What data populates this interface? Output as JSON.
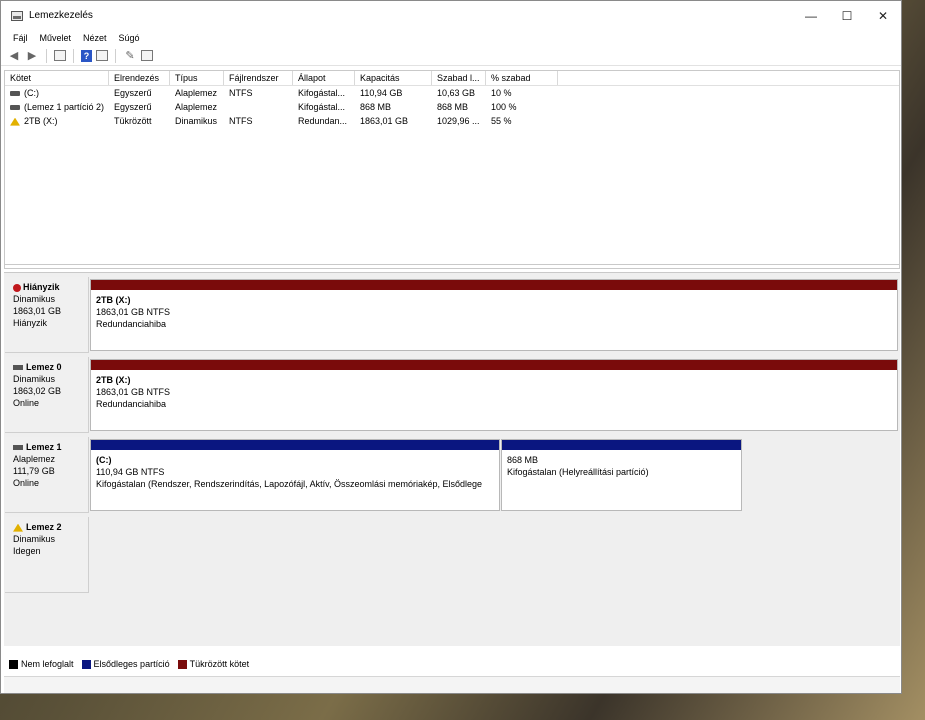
{
  "window": {
    "title": "Lemezkezelés"
  },
  "menu": [
    "Fájl",
    "Művelet",
    "Nézet",
    "Súgó"
  ],
  "columns": [
    "Kötet",
    "Elrendezés",
    "Típus",
    "Fájlrendszer",
    "Állapot",
    "Kapacitás",
    "Szabad l...",
    "% szabad"
  ],
  "volumes": [
    {
      "kotet": "(C:)",
      "elrendezes": "Egyszerű",
      "tipus": "Alaplemez",
      "fajlrendszer": "NTFS",
      "allapot": "Kifogástal...",
      "kapacitas": "110,94 GB",
      "szabad": "10,63 GB",
      "szabad_pct": "10 %"
    },
    {
      "kotet": "(Lemez 1 partíció 2)",
      "elrendezes": "Egyszerű",
      "tipus": "Alaplemez",
      "fajlrendszer": "",
      "allapot": "Kifogástal...",
      "kapacitas": "868 MB",
      "szabad": "868 MB",
      "szabad_pct": "100 %"
    },
    {
      "kotet": "2TB (X:)",
      "elrendezes": "Tükrözött",
      "tipus": "Dinamikus",
      "fajlrendszer": "NTFS",
      "allapot": "Redundan...",
      "kapacitas": "1863,01 GB",
      "szabad": "1029,96 ...",
      "szabad_pct": "55 %"
    }
  ],
  "disks": [
    {
      "name": "Hiányzik",
      "type": "Dinamikus",
      "size": "1863,01 GB",
      "status": "Hiányzik",
      "partitions": [
        {
          "title": "2TB  (X:)",
          "detail": "1863,01 GB NTFS",
          "status": "Redundanciahiba"
        }
      ]
    },
    {
      "name": "Lemez 0",
      "type": "Dinamikus",
      "size": "1863,02 GB",
      "status": "Online",
      "partitions": [
        {
          "title": "2TB  (X:)",
          "detail": "1863,01 GB NTFS",
          "status": "Redundanciahiba"
        }
      ]
    },
    {
      "name": "Lemez 1",
      "type": "Alaplemez",
      "size": "111,79 GB",
      "status": "Online",
      "partitions": [
        {
          "title": "(C:)",
          "detail": "110,94 GB NTFS",
          "status": "Kifogástalan (Rendszer, Rendszerindítás, Lapozófájl, Aktív, Összeomlási memóriakép, Elsődlege"
        },
        {
          "title": "",
          "detail": "868 MB",
          "status": "Kifogástalan (Helyreállítási partíció)"
        }
      ]
    },
    {
      "name": "Lemez 2",
      "type": "Dinamikus",
      "size": "",
      "status": "Idegen",
      "partitions": []
    }
  ],
  "legend": [
    {
      "label": "Nem lefoglalt",
      "color": "#000000"
    },
    {
      "label": "Elsődleges partíció",
      "color": "#0a1680"
    },
    {
      "label": "Tükrözött kötet",
      "color": "#7a0b0b"
    }
  ]
}
